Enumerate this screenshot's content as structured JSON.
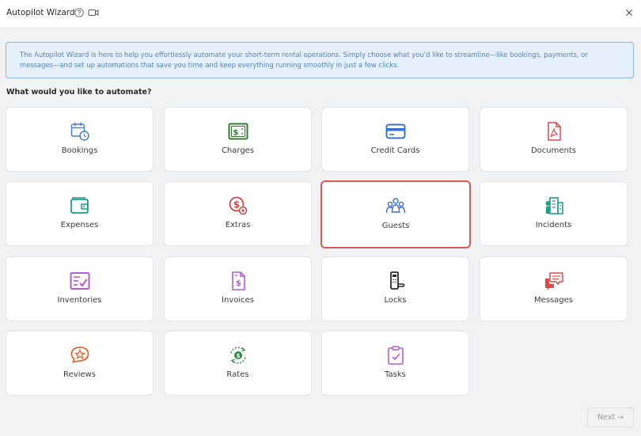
{
  "window": {
    "title": "Autopilot Wizard",
    "help_icon": "question-circle-icon",
    "video_icon": "video-camera-icon",
    "close_icon": "close-x-icon"
  },
  "banner": {
    "text": "The Autopilot Wizard is here to help you effortlessly automate your short-term rental operations. Simply choose what you’d like to streamline—like bookings, payments, or messages—and set up automations that save you time and keep everything running smoothly in just a few clicks."
  },
  "section": {
    "label": "What would you like to automate?"
  },
  "options": [
    {
      "label": "Bookings",
      "icon": "calendar-clock-icon",
      "color": "#4e7fd1"
    },
    {
      "label": "Charges",
      "icon": "dollar-bill-icon",
      "color": "#2e7d32"
    },
    {
      "label": "Credit Cards",
      "icon": "credit-card-icon",
      "color": "#3b6fd4"
    },
    {
      "label": "Documents",
      "icon": "pdf-document-icon",
      "color": "#e04848"
    },
    {
      "label": "Expenses",
      "icon": "wallet-icon",
      "color": "#1f9e8a"
    },
    {
      "label": "Extras",
      "icon": "dollar-plus-icon",
      "color": "#d84343"
    },
    {
      "label": "Guests",
      "icon": "users-group-icon",
      "color": "#3b6fd4"
    },
    {
      "label": "Incidents",
      "icon": "building-icon",
      "color": "#1f9e8a"
    },
    {
      "label": "Inventories",
      "icon": "checklist-icon",
      "color": "#b65bd6"
    },
    {
      "label": "Invoices",
      "icon": "invoice-dollar-icon",
      "color": "#b65bd6"
    },
    {
      "label": "Locks",
      "icon": "door-lock-icon",
      "color": "#2b2b2b"
    },
    {
      "label": "Messages",
      "icon": "chat-bubbles-icon",
      "color": "#e04848"
    },
    {
      "label": "Reviews",
      "icon": "star-badge-icon",
      "color": "#e86a2e"
    },
    {
      "label": "Rates",
      "icon": "dollar-cycle-icon",
      "color": "#2e8b3e"
    },
    {
      "label": "Tasks",
      "icon": "clipboard-check-icon",
      "color": "#b65bd6"
    }
  ],
  "selected_option": "Guests",
  "footer": {
    "next_label": "Next →"
  }
}
